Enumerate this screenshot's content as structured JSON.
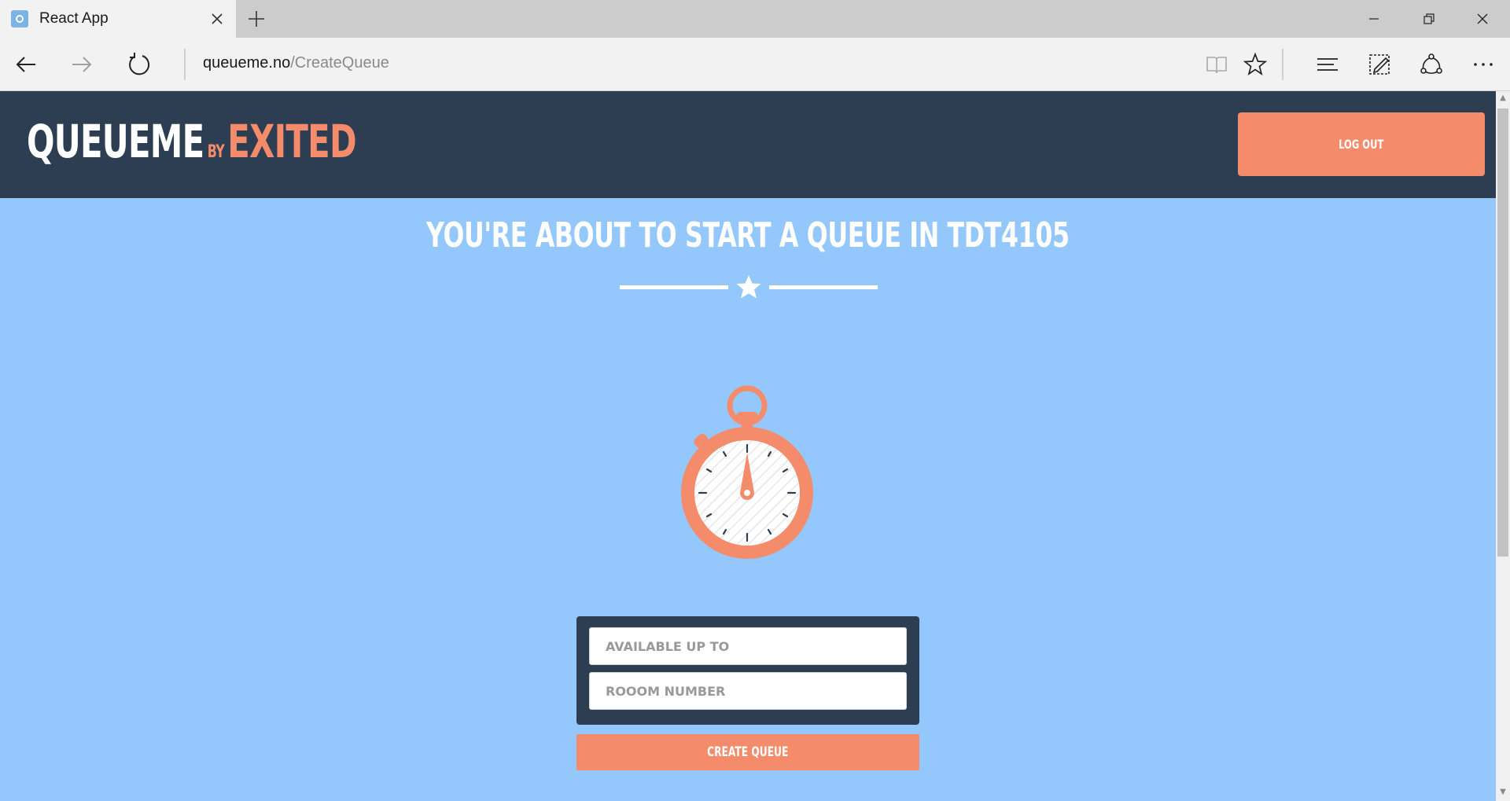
{
  "browser": {
    "tab_title": "React App",
    "address_host": "queueme.no",
    "address_path": "/CreateQueue"
  },
  "header": {
    "brand_main": "QUEUEME",
    "brand_by": "BY",
    "brand_accent": "EXITED",
    "logout_label": "LOG OUT"
  },
  "main": {
    "headline": "YOU'RE ABOUT TO START A QUEUE IN TDT4105"
  },
  "form": {
    "available_placeholder": "AVAILABLE UP TO",
    "room_placeholder": "ROOOM NUMBER",
    "submit_label": "CREATE QUEUE"
  },
  "colors": {
    "page_background": "#94c8fc",
    "header_background": "#2e3e52",
    "accent": "#f48c6c",
    "text_light": "#ffffff"
  },
  "icons": {
    "tab_favicon": "react-app-favicon",
    "back": "back-arrow-icon",
    "forward": "forward-arrow-icon",
    "refresh": "refresh-icon",
    "reading_view": "reading-view-icon",
    "favorite": "star-icon",
    "hub": "hub-icon",
    "web_note": "web-note-icon",
    "share": "share-icon",
    "more": "more-icon",
    "stopwatch": "stopwatch-icon",
    "divider_star": "star-icon"
  }
}
